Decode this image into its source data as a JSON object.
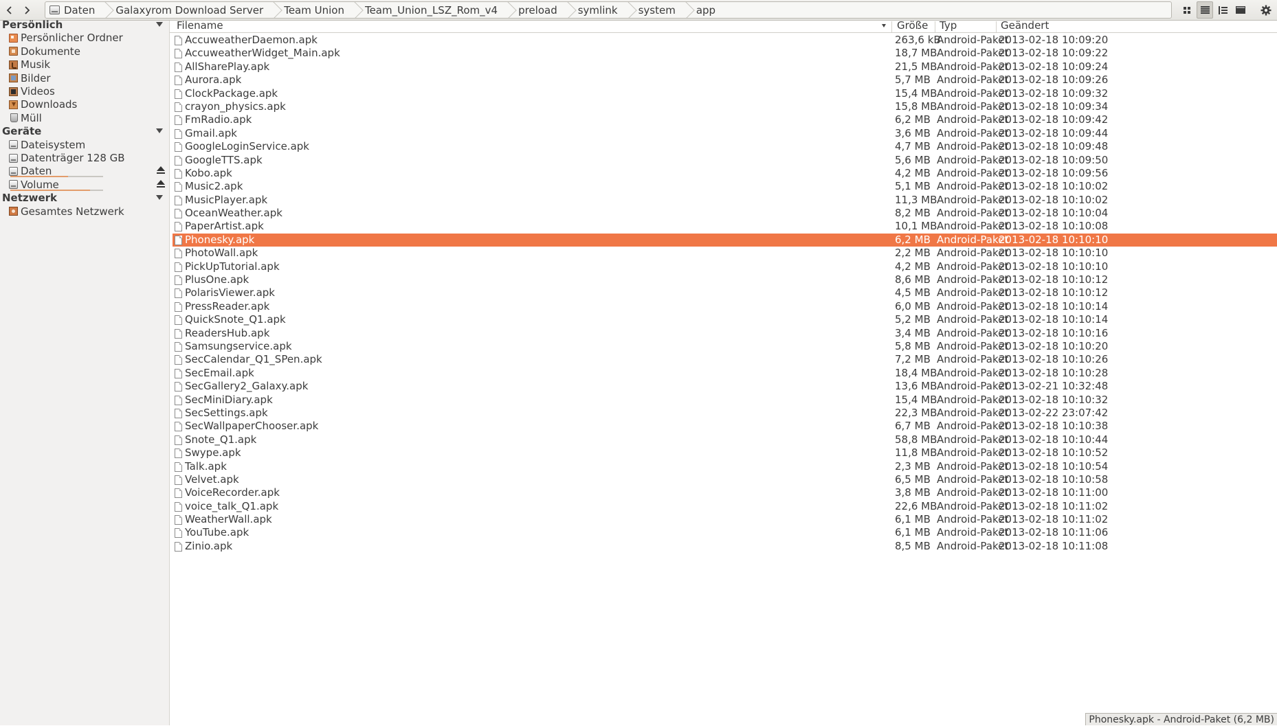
{
  "toolbar": {
    "back_icon": "chevron-left-icon",
    "forward_icon": "chevron-right-icon",
    "breadcrumbs": [
      "Daten",
      "Galaxyrom Download Server",
      "Team Union",
      "Team_Union_LSZ_Rom_v4",
      "preload",
      "symlink",
      "system",
      "app"
    ],
    "view_buttons": [
      "icon-view-icon",
      "list-view-icon",
      "compact-view-icon",
      "preview-icon",
      "gear-icon"
    ]
  },
  "sidebar": {
    "sections": [
      {
        "title": "Persönlich",
        "items": [
          {
            "label": "Persönlicher Ordner",
            "icon": "home-folder-icon"
          },
          {
            "label": "Dokumente",
            "icon": "documents-folder-icon"
          },
          {
            "label": "Musik",
            "icon": "music-folder-icon"
          },
          {
            "label": "Bilder",
            "icon": "pictures-folder-icon"
          },
          {
            "label": "Videos",
            "icon": "videos-folder-icon"
          },
          {
            "label": "Downloads",
            "icon": "downloads-folder-icon"
          },
          {
            "label": "Müll",
            "icon": "trash-icon"
          }
        ]
      },
      {
        "title": "Geräte",
        "items": [
          {
            "label": "Dateisystem",
            "icon": "drive-icon"
          },
          {
            "label": "Datenträger 128 GB",
            "icon": "drive-icon"
          },
          {
            "label": "Daten",
            "icon": "drive-icon",
            "usage": 0.62,
            "ejectable": true
          },
          {
            "label": "Volume",
            "icon": "drive-icon",
            "usage": 0.86,
            "ejectable": true
          }
        ]
      },
      {
        "title": "Netzwerk",
        "items": [
          {
            "label": "Gesamtes Netzwerk",
            "icon": "network-icon"
          }
        ]
      }
    ]
  },
  "filelist": {
    "columns": {
      "name": "Filename",
      "size": "Größe",
      "type": "Typ",
      "modified": "Geändert"
    },
    "sort_column": "Filename",
    "selected_index": 15,
    "rows": [
      {
        "name": "AccuweatherDaemon.apk",
        "size": "263,6 kB",
        "type": "Android-Paket",
        "modified": "2013-02-18 10:09:20"
      },
      {
        "name": "AccuweatherWidget_Main.apk",
        "size": "18,7 MB",
        "type": "Android-Paket",
        "modified": "2013-02-18 10:09:22"
      },
      {
        "name": "AllSharePlay.apk",
        "size": "21,5 MB",
        "type": "Android-Paket",
        "modified": "2013-02-18 10:09:24"
      },
      {
        "name": "Aurora.apk",
        "size": "5,7 MB",
        "type": "Android-Paket",
        "modified": "2013-02-18 10:09:26"
      },
      {
        "name": "ClockPackage.apk",
        "size": "15,4 MB",
        "type": "Android-Paket",
        "modified": "2013-02-18 10:09:32"
      },
      {
        "name": "crayon_physics.apk",
        "size": "15,8 MB",
        "type": "Android-Paket",
        "modified": "2013-02-18 10:09:34"
      },
      {
        "name": "FmRadio.apk",
        "size": "6,2 MB",
        "type": "Android-Paket",
        "modified": "2013-02-18 10:09:42"
      },
      {
        "name": "Gmail.apk",
        "size": "3,6 MB",
        "type": "Android-Paket",
        "modified": "2013-02-18 10:09:44"
      },
      {
        "name": "GoogleLoginService.apk",
        "size": "4,7 MB",
        "type": "Android-Paket",
        "modified": "2013-02-18 10:09:48"
      },
      {
        "name": "GoogleTTS.apk",
        "size": "5,6 MB",
        "type": "Android-Paket",
        "modified": "2013-02-18 10:09:50"
      },
      {
        "name": "Kobo.apk",
        "size": "4,2 MB",
        "type": "Android-Paket",
        "modified": "2013-02-18 10:09:56"
      },
      {
        "name": "Music2.apk",
        "size": "5,1 MB",
        "type": "Android-Paket",
        "modified": "2013-02-18 10:10:02"
      },
      {
        "name": "MusicPlayer.apk",
        "size": "11,3 MB",
        "type": "Android-Paket",
        "modified": "2013-02-18 10:10:02"
      },
      {
        "name": "OceanWeather.apk",
        "size": "8,2 MB",
        "type": "Android-Paket",
        "modified": "2013-02-18 10:10:04"
      },
      {
        "name": "PaperArtist.apk",
        "size": "10,1 MB",
        "type": "Android-Paket",
        "modified": "2013-02-18 10:10:08"
      },
      {
        "name": "Phonesky.apk",
        "size": "6,2 MB",
        "type": "Android-Paket",
        "modified": "2013-02-18 10:10:10"
      },
      {
        "name": "PhotoWall.apk",
        "size": "2,2 MB",
        "type": "Android-Paket",
        "modified": "2013-02-18 10:10:10"
      },
      {
        "name": "PickUpTutorial.apk",
        "size": "4,2 MB",
        "type": "Android-Paket",
        "modified": "2013-02-18 10:10:10"
      },
      {
        "name": "PlusOne.apk",
        "size": "8,6 MB",
        "type": "Android-Paket",
        "modified": "2013-02-18 10:10:12"
      },
      {
        "name": "PolarisViewer.apk",
        "size": "4,5 MB",
        "type": "Android-Paket",
        "modified": "2013-02-18 10:10:12"
      },
      {
        "name": "PressReader.apk",
        "size": "6,0 MB",
        "type": "Android-Paket",
        "modified": "2013-02-18 10:10:14"
      },
      {
        "name": "QuickSnote_Q1.apk",
        "size": "5,2 MB",
        "type": "Android-Paket",
        "modified": "2013-02-18 10:10:14"
      },
      {
        "name": "ReadersHub.apk",
        "size": "3,4 MB",
        "type": "Android-Paket",
        "modified": "2013-02-18 10:10:16"
      },
      {
        "name": "Samsungservice.apk",
        "size": "5,8 MB",
        "type": "Android-Paket",
        "modified": "2013-02-18 10:10:20"
      },
      {
        "name": "SecCalendar_Q1_SPen.apk",
        "size": "7,2 MB",
        "type": "Android-Paket",
        "modified": "2013-02-18 10:10:26"
      },
      {
        "name": "SecEmail.apk",
        "size": "18,4 MB",
        "type": "Android-Paket",
        "modified": "2013-02-18 10:10:28"
      },
      {
        "name": "SecGallery2_Galaxy.apk",
        "size": "13,6 MB",
        "type": "Android-Paket",
        "modified": "2013-02-21 10:32:48"
      },
      {
        "name": "SecMiniDiary.apk",
        "size": "15,4 MB",
        "type": "Android-Paket",
        "modified": "2013-02-18 10:10:32"
      },
      {
        "name": "SecSettings.apk",
        "size": "22,3 MB",
        "type": "Android-Paket",
        "modified": "2013-02-22 23:07:42"
      },
      {
        "name": "SecWallpaperChooser.apk",
        "size": "6,7 MB",
        "type": "Android-Paket",
        "modified": "2013-02-18 10:10:38"
      },
      {
        "name": "Snote_Q1.apk",
        "size": "58,8 MB",
        "type": "Android-Paket",
        "modified": "2013-02-18 10:10:44"
      },
      {
        "name": "Swype.apk",
        "size": "11,8 MB",
        "type": "Android-Paket",
        "modified": "2013-02-18 10:10:52"
      },
      {
        "name": "Talk.apk",
        "size": "2,3 MB",
        "type": "Android-Paket",
        "modified": "2013-02-18 10:10:54"
      },
      {
        "name": "Velvet.apk",
        "size": "6,5 MB",
        "type": "Android-Paket",
        "modified": "2013-02-18 10:10:58"
      },
      {
        "name": "VoiceRecorder.apk",
        "size": "3,8 MB",
        "type": "Android-Paket",
        "modified": "2013-02-18 10:11:00"
      },
      {
        "name": "voice_talk_Q1.apk",
        "size": "22,6 MB",
        "type": "Android-Paket",
        "modified": "2013-02-18 10:11:02"
      },
      {
        "name": "WeatherWall.apk",
        "size": "6,1 MB",
        "type": "Android-Paket",
        "modified": "2013-02-18 10:11:02"
      },
      {
        "name": "YouTube.apk",
        "size": "6,1 MB",
        "type": "Android-Paket",
        "modified": "2013-02-18 10:11:06"
      },
      {
        "name": "Zinio.apk",
        "size": "8,5 MB",
        "type": "Android-Paket",
        "modified": "2013-02-18 10:11:08"
      }
    ]
  },
  "statusbar": {
    "text": "Phonesky.apk - Android-Paket (6,2 MB)"
  },
  "colors": {
    "selection": "#f07746",
    "selection_text": "#ffffff",
    "sidebar_bg": "#f2f1f0",
    "usage_fill": "#e39c6b"
  }
}
